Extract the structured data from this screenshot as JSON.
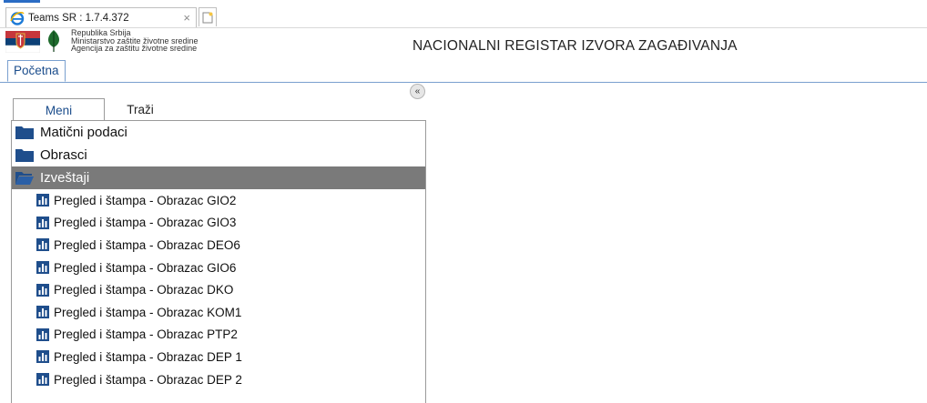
{
  "browser": {
    "tab_title": "Teams SR : 1.7.4.372",
    "close_glyph": "×"
  },
  "header": {
    "org_lines": [
      "Republika Srbija",
      "Ministarstvo zaštite životne sredine",
      "Agencija za zaštitu životne sredine"
    ],
    "app_title": "NACIONALNI REGISTAR IZVORA ZAGAĐIVANJA"
  },
  "page_tabs": [
    {
      "label": "Početna"
    }
  ],
  "panel": {
    "collapse_glyph": "«",
    "tabs": [
      {
        "label": "Meni",
        "active": true
      },
      {
        "label": "Traži",
        "active": false
      }
    ]
  },
  "menu": {
    "categories": [
      {
        "label": "Matični podaci",
        "icon": "folder-icon"
      },
      {
        "label": "Obrasci",
        "icon": "folder-icon"
      },
      {
        "label": "Izveštaji",
        "icon": "folder-open-icon",
        "selected": true
      }
    ],
    "reports": [
      {
        "label": "Pregled i štampa - Obrazac GIO2"
      },
      {
        "label": "Pregled i štampa - Obrazac GIO3"
      },
      {
        "label": "Pregled i štampa - Obrazac DEO6"
      },
      {
        "label": "Pregled i štampa - Obrazac GIO6"
      },
      {
        "label": "Pregled i štampa - Obrazac DKO"
      },
      {
        "label": "Pregled i štampa - Obrazac KOM1"
      },
      {
        "label": "Pregled i štampa - Obrazac PTP2"
      },
      {
        "label": "Pregled i štampa - Obrazac DEP 1"
      },
      {
        "label": "Pregled i štampa - Obrazac DEP 2"
      }
    ]
  },
  "colors": {
    "accent": "#2b6cc4",
    "tab_text": "#1b4d8c",
    "folder": "#1f4e8c",
    "selected_row": "#7a7a7a"
  }
}
